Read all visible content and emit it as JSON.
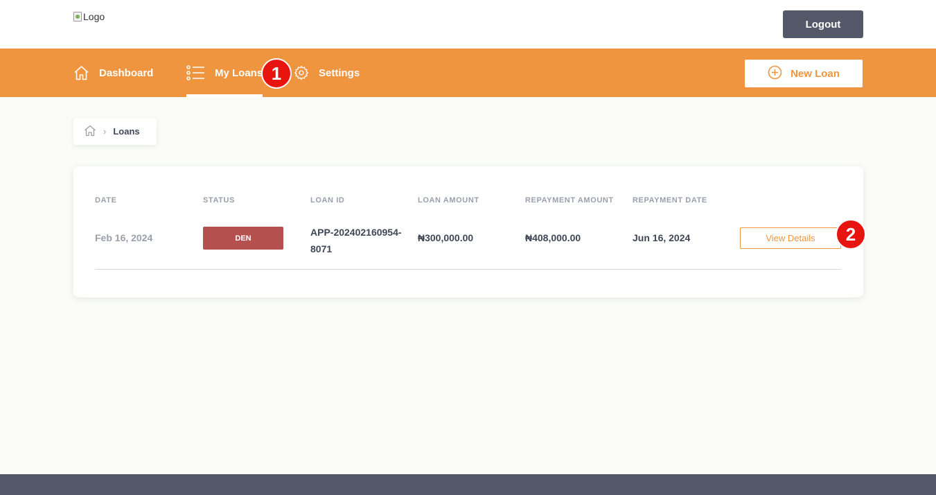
{
  "header": {
    "logo_alt": "Logo",
    "logout_label": "Logout"
  },
  "nav": {
    "items": [
      {
        "label": "Dashboard",
        "icon": "home-icon"
      },
      {
        "label": "My Loans",
        "icon": "list-icon",
        "active": true
      },
      {
        "label": "Settings",
        "icon": "gear-icon"
      }
    ],
    "new_loan_label": "New Loan",
    "new_loan_icon": "plus-circle-icon"
  },
  "annotations": {
    "badge_1": "1",
    "badge_2": "2"
  },
  "breadcrumb": {
    "home_icon": "home-icon",
    "current": "Loans"
  },
  "table": {
    "headers": [
      "DATE",
      "STATUS",
      "LOAN ID",
      "LOAN AMOUNT",
      "REPAYMENT AMOUNT",
      "REPAYMENT DATE"
    ],
    "rows": [
      {
        "date": "Feb 16, 2024",
        "status": "DEN",
        "loan_id_line1": "APP-202402160954-",
        "loan_id_line2": "8071",
        "loan_amount": "₦300,000.00",
        "repayment_amount": "₦408,000.00",
        "repayment_date": "Jun 16, 2024",
        "action_label": "View Details"
      }
    ]
  },
  "colors": {
    "accent": "#ef943f",
    "dark": "#535968",
    "status_denied": "#b5504e",
    "badge_red": "#e8140f",
    "background": "#fbfcf7"
  }
}
